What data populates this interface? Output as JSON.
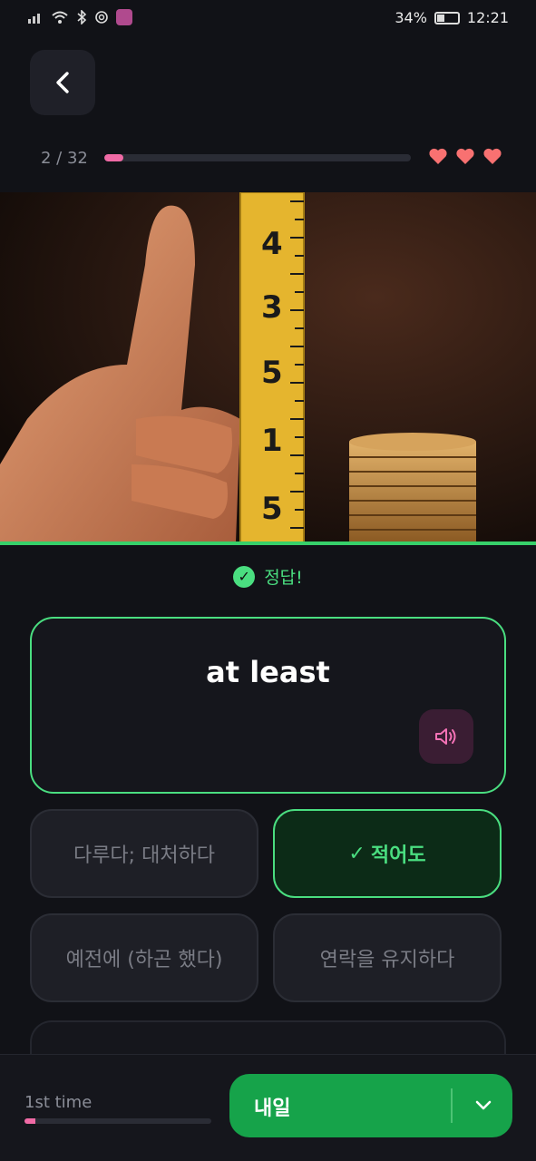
{
  "status_bar": {
    "battery": "34%",
    "time": "12:21"
  },
  "header": {
    "progress_text": "2 / 32",
    "progress_fraction": 0.0625,
    "hearts": 3,
    "heart_color": "#f87171"
  },
  "feedback": {
    "text": "정답!",
    "color": "#4ade80"
  },
  "word": {
    "text": "at least"
  },
  "options": [
    {
      "label": "다루다; 대처하다",
      "correct": false
    },
    {
      "label": "적어도",
      "correct": true
    },
    {
      "label": "예전에 (하곤 했다)",
      "correct": false
    },
    {
      "label": "연락을 유지하다",
      "correct": false
    }
  ],
  "bottom": {
    "time_label": "1st time",
    "time_fraction": 0.06,
    "next_label": "내일",
    "accent": "#16a34a"
  },
  "icons": {
    "back": "chevron-left-icon",
    "audio": "speaker-icon",
    "dropdown": "chevron-down-icon"
  }
}
